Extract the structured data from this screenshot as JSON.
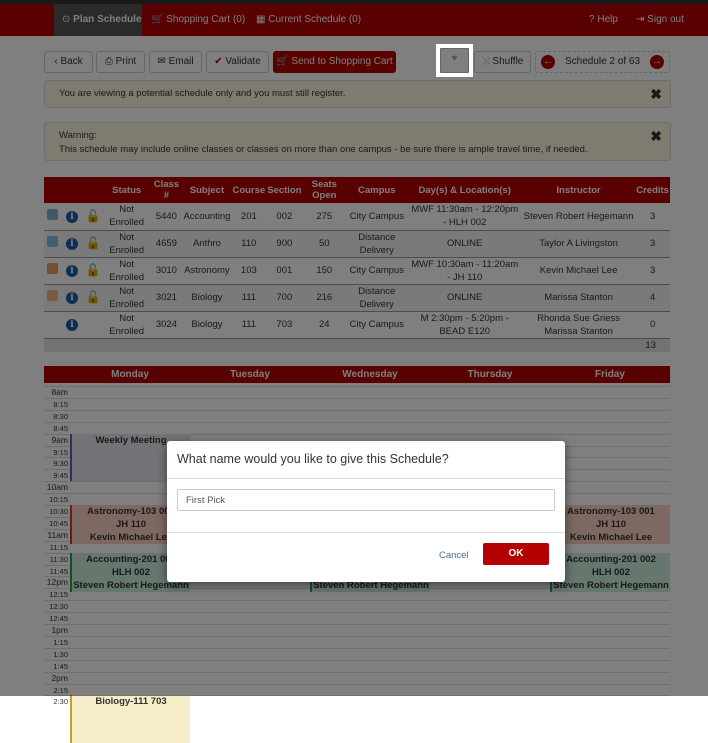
{
  "nav": {
    "items": [
      "Plan Schedule",
      "Shopping Cart (0)",
      "Current Schedule (0)"
    ],
    "help": "Help",
    "signout": "Sign out"
  },
  "toolbar": {
    "back": "Back",
    "print": "Print",
    "email": "Email",
    "validate": "Validate",
    "send": "Send to Shopping Cart",
    "shuffle": "Shuffle",
    "schedule_counter": "Schedule 2 of 63"
  },
  "alerts": {
    "notice": "You are viewing a potential schedule only and you must still register.",
    "warning_title": "Warning:",
    "warning_text": "This schedule may include online classes or classes on more than one campus - be sure there is ample travel time, if needed."
  },
  "table": {
    "headers": [
      "Status",
      "Class #",
      "Subject",
      "Course",
      "Section",
      "Seats Open",
      "Campus",
      "Day(s) & Location(s)",
      "Instructor",
      "Credits"
    ],
    "rows": [
      {
        "color": "#7fb3d5",
        "locked": true,
        "cells": [
          "Not Enrolled",
          "5440",
          "Accounting",
          "201",
          "002",
          "275",
          "City Campus",
          "MWF 11:30am - 12:20pm - HLH 002",
          "Steven Robert Hegemann",
          "3"
        ]
      },
      {
        "color": "#7fc0e0",
        "locked": true,
        "cells": [
          "Not Enrolled",
          "4659",
          "Anthro",
          "110",
          "900",
          "50",
          "Distance Delivery",
          "ONLINE",
          "Taylor A Livingston",
          "3"
        ]
      },
      {
        "color": "#e8a060",
        "locked": true,
        "cells": [
          "Not Enrolled",
          "3010",
          "Astronomy",
          "103",
          "001",
          "150",
          "City Campus",
          "MWF 10:30am - 11:20am - JH 110",
          "Kevin Michael Lee",
          "3"
        ]
      },
      {
        "color": "#f0b890",
        "locked": true,
        "cells": [
          "Not Enrolled",
          "3021",
          "Biology",
          "111",
          "700",
          "216",
          "Distance Delivery",
          "ONLINE",
          "Marissa Stanton",
          "4"
        ]
      },
      {
        "color": "",
        "locked": false,
        "cells": [
          "Not Enrolled",
          "3024",
          "Biology",
          "111",
          "703",
          "24",
          "City Campus",
          "M 2:30pm - 5:20pm - BEAD E120",
          "Rhonda Sue Griess Marissa Stanton",
          "0"
        ]
      }
    ],
    "total_credits": "13"
  },
  "calendar": {
    "days": [
      "Monday",
      "Tuesday",
      "Wednesday",
      "Thursday",
      "Friday"
    ],
    "times": [
      "8am",
      "8:15",
      "8:30",
      "8:45",
      "9am",
      "9:15",
      "9:30",
      "9:45",
      "10am",
      "10:15",
      "10:30",
      "10:45",
      "11am",
      "11:15",
      "11:30",
      "11:45",
      "12pm",
      "12:15",
      "12:30",
      "12:45",
      "1pm",
      "1:15",
      "1:30",
      "1:45",
      "2pm",
      "2:15",
      "2:30"
    ],
    "events": [
      {
        "title": "Weekly Meeting",
        "line2": "",
        "line3": "",
        "days": [
          0
        ],
        "start": 4,
        "end": 8,
        "color": "#e6e6ee",
        "border": "#5566aa"
      },
      {
        "title": "Astronomy-103 001",
        "line2": "JH 110",
        "line3": "Kevin Michael Lee",
        "days": [
          0,
          2,
          4
        ],
        "start": 10,
        "end": 13.3,
        "color": "#fbd3c3",
        "border": "#d04020"
      },
      {
        "title": "Accounting-201 002",
        "line2": "HLH 002",
        "line3": "Steven Robert Hegemann",
        "days": [
          0,
          2,
          4
        ],
        "start": 14,
        "end": 17.3,
        "color": "#cdeedd",
        "border": "#20a050"
      },
      {
        "title": "Biology-111 703",
        "line2": "",
        "line3": "",
        "days": [
          0
        ],
        "start": 26,
        "end": 30,
        "color": "#f5ecc8",
        "border": "#c0a030"
      }
    ]
  },
  "modal": {
    "title": "What name would you like to give this Schedule?",
    "input_value": "First Pick",
    "cancel": "Cancel",
    "ok": "OK"
  }
}
